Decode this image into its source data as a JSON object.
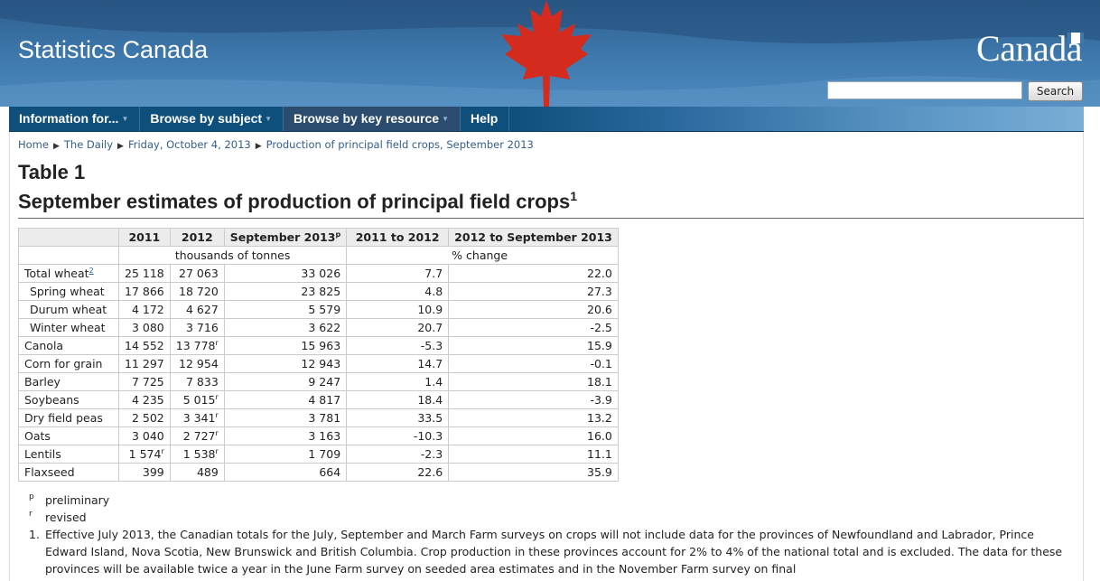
{
  "site": {
    "title": "Statistics Canada",
    "wordmark": "Canada"
  },
  "search": {
    "placeholder": "",
    "button_label": "Search"
  },
  "nav": [
    {
      "label": "Information for...",
      "has_menu": true,
      "active": false
    },
    {
      "label": "Browse by subject",
      "has_menu": true,
      "active": false
    },
    {
      "label": "Browse by key resource",
      "has_menu": true,
      "active": true
    },
    {
      "label": "Help",
      "has_menu": false,
      "active": false
    }
  ],
  "breadcrumb": [
    "Home",
    "The Daily",
    "Friday, October 4, 2013",
    "Production of principal field crops, September 2013"
  ],
  "table_label": "Table 1",
  "page_title": "September estimates of production of principal field crops",
  "page_title_footnote": "1",
  "table": {
    "headers": [
      "",
      "2011",
      "2012",
      "September 2013",
      "2011 to 2012",
      "2012 to September 2013"
    ],
    "sept_header_sup": "p",
    "unit_thousands": "thousands of tonnes",
    "unit_percent": "% change",
    "rows": [
      {
        "crop": "Total wheat",
        "sup": "2",
        "indent": false,
        "y2011": "25 118",
        "y2011r": "",
        "y2012": "27 063",
        "y2012r": "",
        "sep2013": "33 026",
        "chg1": "7.7",
        "chg2": "22.0"
      },
      {
        "crop": "Spring wheat",
        "sup": "",
        "indent": true,
        "y2011": "17 866",
        "y2011r": "",
        "y2012": "18 720",
        "y2012r": "",
        "sep2013": "23 825",
        "chg1": "4.8",
        "chg2": "27.3"
      },
      {
        "crop": "Durum wheat",
        "sup": "",
        "indent": true,
        "y2011": "4 172",
        "y2011r": "",
        "y2012": "4 627",
        "y2012r": "",
        "sep2013": "5 579",
        "chg1": "10.9",
        "chg2": "20.6"
      },
      {
        "crop": "Winter wheat",
        "sup": "",
        "indent": true,
        "y2011": "3 080",
        "y2011r": "",
        "y2012": "3 716",
        "y2012r": "",
        "sep2013": "3 622",
        "chg1": "20.7",
        "chg2": "-2.5"
      },
      {
        "crop": "Canola",
        "sup": "",
        "indent": false,
        "y2011": "14 552",
        "y2011r": "",
        "y2012": "13 778",
        "y2012r": "r",
        "sep2013": "15 963",
        "chg1": "-5.3",
        "chg2": "15.9"
      },
      {
        "crop": "Corn for grain",
        "sup": "",
        "indent": false,
        "y2011": "11 297",
        "y2011r": "",
        "y2012": "12 954",
        "y2012r": "",
        "sep2013": "12 943",
        "chg1": "14.7",
        "chg2": "-0.1"
      },
      {
        "crop": "Barley",
        "sup": "",
        "indent": false,
        "y2011": "7 725",
        "y2011r": "",
        "y2012": "7 833",
        "y2012r": "",
        "sep2013": "9 247",
        "chg1": "1.4",
        "chg2": "18.1"
      },
      {
        "crop": "Soybeans",
        "sup": "",
        "indent": false,
        "y2011": "4 235",
        "y2011r": "",
        "y2012": "5 015",
        "y2012r": "r",
        "sep2013": "4 817",
        "chg1": "18.4",
        "chg2": "-3.9"
      },
      {
        "crop": "Dry field peas",
        "sup": "",
        "indent": false,
        "y2011": "2 502",
        "y2011r": "",
        "y2012": "3 341",
        "y2012r": "r",
        "sep2013": "3 781",
        "chg1": "33.5",
        "chg2": "13.2"
      },
      {
        "crop": "Oats",
        "sup": "",
        "indent": false,
        "y2011": "3 040",
        "y2011r": "",
        "y2012": "2 727",
        "y2012r": "r",
        "sep2013": "3 163",
        "chg1": "-10.3",
        "chg2": "16.0"
      },
      {
        "crop": "Lentils",
        "sup": "",
        "indent": false,
        "y2011": "1 574",
        "y2011r": "r",
        "y2012": "1 538",
        "y2012r": "r",
        "sep2013": "1 709",
        "chg1": "-2.3",
        "chg2": "11.1"
      },
      {
        "crop": "Flaxseed",
        "sup": "",
        "indent": false,
        "y2011": "399",
        "y2011r": "",
        "y2012": "489",
        "y2012r": "",
        "sep2013": "664",
        "chg1": "22.6",
        "chg2": "35.9"
      }
    ]
  },
  "notes": [
    {
      "symbol": "p",
      "text": "preliminary"
    },
    {
      "symbol": "r",
      "text": "revised"
    }
  ],
  "footnote": {
    "number": "1.",
    "text": "Effective July 2013, the Canadian totals for the July, September and March Farm surveys on crops will not include data for the provinces of Newfoundland and Labrador, Prince Edward Island, Nova Scotia, New Brunswick and British Columbia. Crop production in these provinces account for 2% to 4% of the national total and is excluded. The data for these provinces will be available twice a year in the June Farm survey on seeded area estimates and in the November Farm survey on final"
  },
  "colors": {
    "nav_bg": "#0f4f7c",
    "header_bg": "#3f79ad",
    "maple_red": "#d52b1e",
    "link": "#335e8a"
  }
}
